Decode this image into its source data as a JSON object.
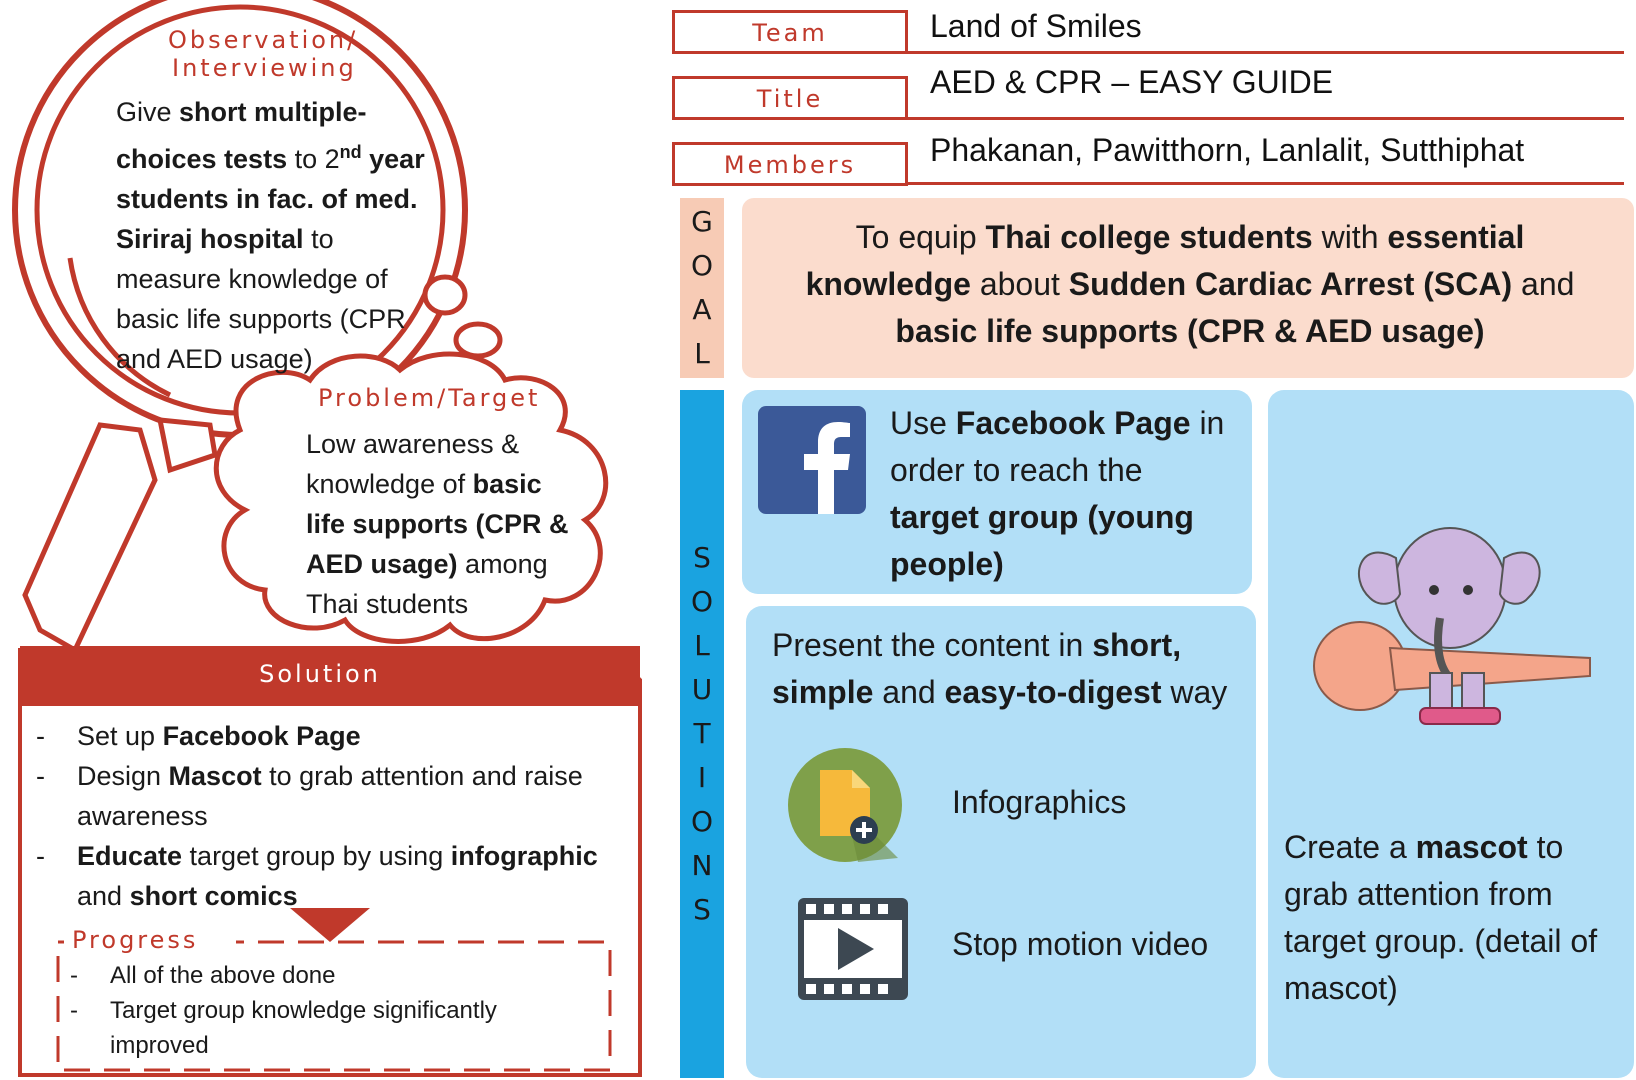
{
  "header": {
    "team_label": "Team",
    "team_value": "Land of Smiles",
    "title_label": "Title",
    "title_value": "AED & CPR – EASY GUIDE",
    "members_label": "Members",
    "members_value": "Phakanan, Pawitthorn, Lanlalit, Sutthiphat"
  },
  "left": {
    "observation_title_1": "Observation/",
    "observation_title_2": "Interviewing",
    "observation_body": {
      "t1": "Give ",
      "b1": "short multiple-choices tests",
      "t2": " to 2",
      "sup": "nd",
      "b2": " year students in fac. of med. Siriraj hospital",
      "t3": " to measure knowledge of basic life supports (CPR and AED usage)"
    },
    "problem_title": "Problem/Target",
    "problem_body": {
      "t1": "Low awareness & knowledge of ",
      "b1": "basic life supports (CPR & AED usage)",
      "t2": " among Thai students"
    },
    "solution_title": "Solution",
    "solution_items": [
      {
        "t1": "Set up ",
        "b1": "Facebook Page",
        "t2": ""
      },
      {
        "t1": "Design ",
        "b1": "Mascot",
        "t2": " to grab attention and raise awareness"
      },
      {
        "b0": "Educate",
        "t1": " target group by using ",
        "b1": "infographic",
        "t2": " and ",
        "b2": "short comics"
      }
    ],
    "progress_title": "Progress",
    "progress_items": [
      "All of the above done",
      "Target group knowledge significantly improved"
    ]
  },
  "goal": {
    "label_letters": [
      "G",
      "O",
      "A",
      "L"
    ],
    "text": {
      "t1": "To equip ",
      "b1": "Thai college students",
      "t2": " with ",
      "b2": "essential knowledge",
      "t3": " about ",
      "b3": "Sudden Cardiac Arrest (SCA)",
      "t4": " and ",
      "b4": "basic life supports (CPR & AED usage)"
    }
  },
  "solutions": {
    "label_letters": [
      "S",
      "O",
      "L",
      "U",
      "T",
      "I",
      "O",
      "N",
      "S"
    ],
    "facebook": {
      "t1": "Use ",
      "b1": "Facebook Page",
      "t2": " in order to reach the ",
      "b2": "target group (young people)"
    },
    "present": {
      "t1": "Present the content in ",
      "b1": "short, simple",
      "t2": " and ",
      "b2": "easy-to-digest",
      "t3": " way"
    },
    "infographics_label": "Infographics",
    "video_label": "Stop motion video",
    "mascot": {
      "t1": "Create a ",
      "b1": "mascot",
      "t2": " to grab attention from target group. (detail of mascot)"
    }
  },
  "colors": {
    "accent_red": "#c0392b",
    "goal_bg": "#fbdccd",
    "goal_strip": "#f7cbb5",
    "solutions_strip": "#1aa3e0",
    "solutions_bg": "#b2dff7",
    "facebook_blue": "#3b5998"
  },
  "icons": [
    "magnifier-icon",
    "cloud-icon",
    "facebook-icon",
    "infographic-file-icon",
    "video-play-icon",
    "elephant-mascot-icon"
  ]
}
